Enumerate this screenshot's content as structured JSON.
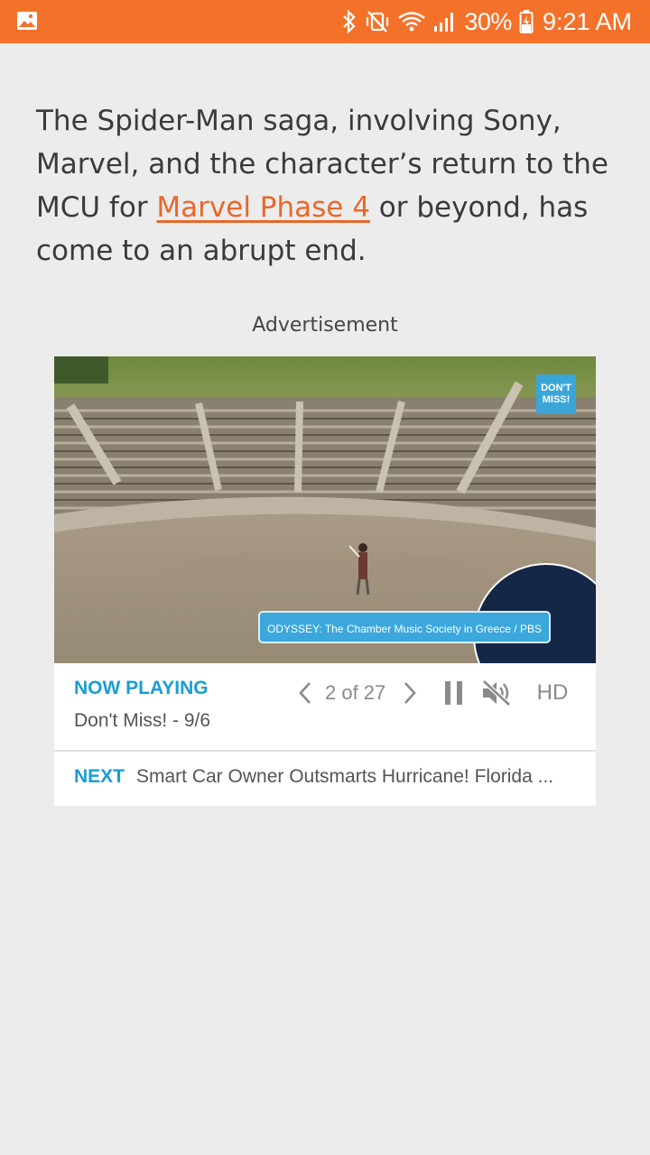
{
  "status_bar": {
    "icons": [
      "gallery-icon",
      "bluetooth-icon",
      "vibrate-mute-icon",
      "wifi-icon",
      "signal-icon",
      "battery-charging-icon"
    ],
    "battery_percent": "30%",
    "time": "9:21 AM",
    "background_color": "#f4712a"
  },
  "article": {
    "text_before_link": "The Spider-Man saga, involving Sony, Marvel, and the character’s return to the MCU for ",
    "link_text": "Marvel Phase 4",
    "text_after_link": " or beyond, has come to an abrupt end.",
    "link_color": "#e8682a"
  },
  "ad": {
    "label": "Advertisement"
  },
  "video_player": {
    "badge_text": "DON'T MISS!",
    "caption": "ODYSSEY: The Chamber Music Society in Greece / PBS",
    "now_playing_label": "NOW PLAYING",
    "now_playing_title": "Don't Miss! - 9/6",
    "counter": "2 of 27",
    "hd_label": "HD",
    "next_label": "NEXT",
    "next_title": "Smart Car Owner Outsmarts Hurricane! Florida ...",
    "accent_color": "#1a9dd4"
  }
}
